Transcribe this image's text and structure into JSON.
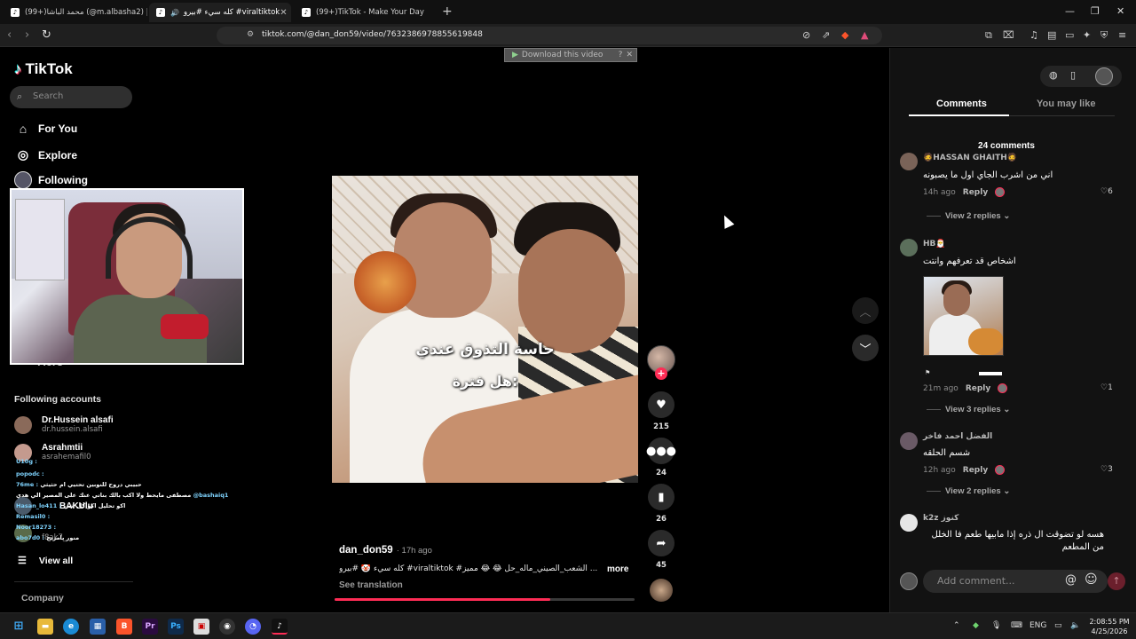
{
  "browser": {
    "tabs": [
      {
        "label": "(99+)محمد الباشا (@m.albasha2) | Tok"
      },
      {
        "label": "كله سيء #بيرو #viraltiktok",
        "active": true
      },
      {
        "label": "(99+)TikTok - Make Your Day"
      }
    ],
    "url": "tiktok.com/@dan_don59/video/7632386978855619848",
    "colors": {
      "accent": "#fe2c55"
    }
  },
  "sidebar": {
    "logo": "TikTok",
    "search_placeholder": "Search",
    "nav": [
      {
        "label": "For You",
        "icon": "home-icon"
      },
      {
        "label": "Explore",
        "icon": "compass-icon"
      },
      {
        "label": "Following",
        "icon": "avatar"
      }
    ],
    "more_label": "More",
    "following_title": "Following accounts",
    "accounts": [
      {
        "name": "Dr.Hussein alsafi",
        "handle": "dr.hussein.alsafi"
      },
      {
        "name": "Asrahmtii",
        "handle": "asrahemafil0"
      },
      {
        "name": "BAKUlu",
        "handle": ""
      },
      {
        "name": "",
        "handle": "f8ak7_"
      }
    ],
    "chat_overlay": [
      {
        "user": "U10g :",
        "text": ""
      },
      {
        "user": "popodc :",
        "text": ""
      },
      {
        "user": "76me :",
        "text": "حبيبي دروح للنوبين تحتيي ام حثيثي"
      },
      {
        "user": "@bashaiq1",
        "text": "مصطفى مايحط ولا اكب بالك بناتي عنك على المصير الي هدي"
      },
      {
        "user": "Hasan_lo411 :",
        "text": "اكو تحليل اكو كل شي"
      },
      {
        "user": "Remasil0 :",
        "text": ""
      },
      {
        "user": "Noor18273 :",
        "text": ""
      },
      {
        "user": "abo7d0 :",
        "text": "منور يامريح"
      }
    ],
    "view_all": "View all",
    "company": "Company"
  },
  "video": {
    "download_bar": "Download this video",
    "download_help": "?",
    "caption_lines": [
      "حاسة التذوق عندي",
      "هل فترة:"
    ],
    "author": "dan_don59",
    "posted_ago": "17h ago",
    "description": "كله سيء 🤡 #بيرو #viraltiktok #الشعب_الصيني_ماله_حل 😂 😂 مميز ...",
    "more_label": "more",
    "see_translation": "See translation",
    "progress": 0.72,
    "likes": "215",
    "comments": "24",
    "saves": "26",
    "shares": "45"
  },
  "panel": {
    "tabs": [
      "Comments",
      "You may like"
    ],
    "comment_count": "24 comments",
    "comments": [
      {
        "name": "🧔HASSAN GHAITH🧔",
        "text": "اني من اشرب الجاي اول ما يصبونه",
        "ago": "14h ago",
        "likes": "6",
        "replies": "View 2 replies"
      },
      {
        "name": "HB🎅",
        "text": "اشخاص قد تعرفهم وانتت",
        "ago": "21m ago",
        "likes": "1",
        "replies": "View 3 replies"
      },
      {
        "name": "الفضل احمد فاخر",
        "text": "شسم الحلقه",
        "ago": "12h ago",
        "likes": "3",
        "replies": "View 2 replies"
      },
      {
        "name": "k2z كنوز",
        "text": "هسه لو تضوقت ال ذره إذا مابيها طعم فا الخلل من المطعم",
        "ago": "",
        "likes": "",
        "replies": ""
      }
    ],
    "reply_label": "Reply",
    "add_comment_placeholder": "Add comment..."
  },
  "taskbar": {
    "lang": "ENG",
    "time": "2:08:55 PM",
    "date": "4/25/2026"
  }
}
